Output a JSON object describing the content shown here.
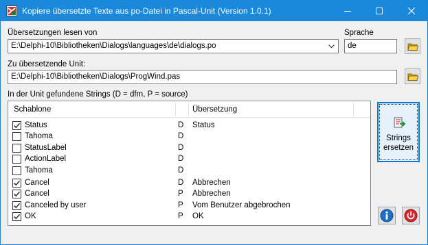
{
  "window": {
    "title": "Kopiere übersetzte Texte aus po-Datei in Pascal-Unit (Version 1.0.1)"
  },
  "form": {
    "po_label": "Übersetzungen lesen von",
    "po_path": "E:\\Delphi-10\\Bibliotheken\\Dialogs\\languages\\de\\dialogs.po",
    "lang_label": "Sprache",
    "lang_value": "de",
    "unit_label": "Zu übersetzende Unit:",
    "unit_path": "E:\\Delphi-10\\Bibliotheken\\Dialogs\\ProgWind.pas",
    "strings_label": "In der Unit gefundene Strings (D = dfm, P = source)"
  },
  "list": {
    "columns": [
      "Schablone",
      "Übersetzung"
    ],
    "rows": [
      {
        "checked": true,
        "name": "Status",
        "source": "D",
        "translation": "Status"
      },
      {
        "checked": false,
        "name": "Tahoma",
        "source": "D",
        "translation": ""
      },
      {
        "checked": false,
        "name": "StatusLabel",
        "source": "D",
        "translation": ""
      },
      {
        "checked": false,
        "name": "ActionLabel",
        "source": "D",
        "translation": ""
      },
      {
        "checked": false,
        "name": "Tahoma",
        "source": "D",
        "translation": ""
      },
      {
        "checked": true,
        "name": "Cancel",
        "source": "D",
        "translation": "Abbrechen"
      },
      {
        "checked": true,
        "name": "Cancel",
        "source": "P",
        "translation": "Abbrechen"
      },
      {
        "checked": true,
        "name": "Canceled by user",
        "source": "P",
        "translation": "Vom Benutzer abgebrochen"
      },
      {
        "checked": true,
        "name": "OK",
        "source": "P",
        "translation": "OK"
      }
    ]
  },
  "buttons": {
    "replace_label_1": "Strings",
    "replace_label_2": "ersetzen"
  },
  "icons": {
    "app": "app-icon",
    "folder": "folder-open-icon",
    "replace": "strings-replace-icon",
    "info": "info-icon",
    "power": "power-icon"
  },
  "colors": {
    "titlebar": "#1a89db",
    "accent": "#0078d7",
    "info": "#1f6fc2",
    "power": "#d9262c"
  }
}
